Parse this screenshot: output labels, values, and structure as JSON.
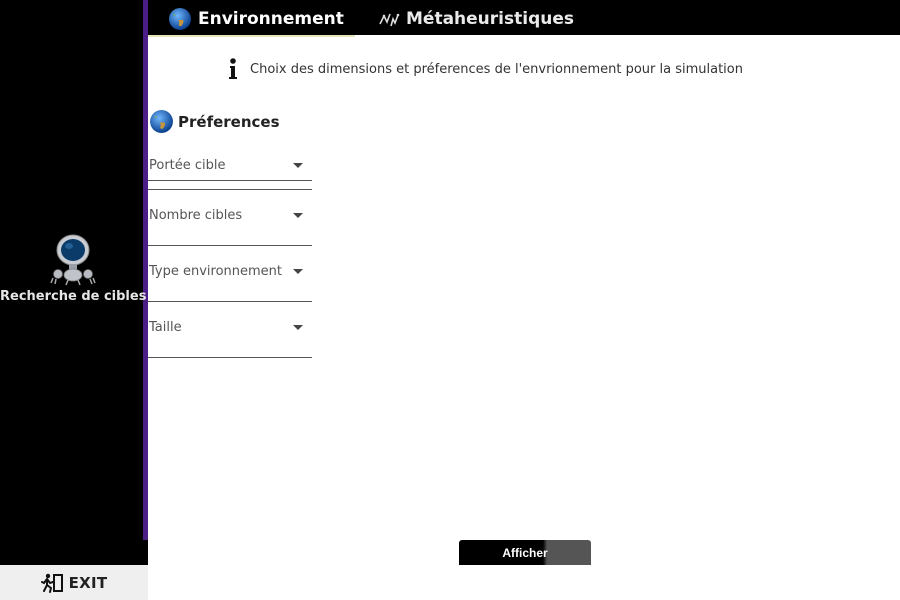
{
  "sidebar": {
    "app_name": "Recherche de cibles",
    "app_icon": "robot-icon",
    "exit_label": "EXIT",
    "exit_icon": "running-exit-icon",
    "accent_color": "#4b1d86"
  },
  "tabs": [
    {
      "label": "Environnement",
      "icon": "globe-icon",
      "active": true
    },
    {
      "label": "Métaheuristiques",
      "icon": "metaheuristics-icon",
      "active": false
    }
  ],
  "info": {
    "icon": "info-icon",
    "text": "Choix des dimensions et préferences de l'envrionnement pour la simulation"
  },
  "preferences": {
    "title": "Préferences",
    "icon": "globe-icon",
    "fields": [
      {
        "label": "Portée cible"
      },
      {
        "label": "Nombre cibles"
      },
      {
        "label": "Type environnement"
      },
      {
        "label": "Taille"
      }
    ]
  },
  "actions": {
    "show_label": "Afficher"
  }
}
